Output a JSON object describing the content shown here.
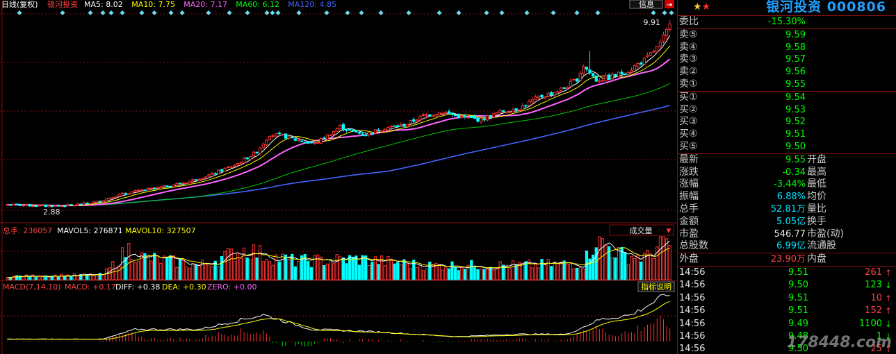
{
  "chart_header": {
    "period_label": "日线(复权)",
    "stock_name": "银河投资",
    "ma": [
      {
        "label": "MA5: 8.02",
        "color": "#ffffff"
      },
      {
        "label": "MA10: 7.75",
        "color": "#ffff00"
      },
      {
        "label": "MA20: 7.17",
        "color": "#ff66ff"
      },
      {
        "label": "MA60: 6.12",
        "color": "#00ff00"
      },
      {
        "label": "MA120: 4.85",
        "color": "#4466ff"
      }
    ],
    "buttons": [
      "信息",
      "指标说明"
    ],
    "high_label": "9.91",
    "low_label": "2.88"
  },
  "volume_header": {
    "total": "总手: 236057",
    "mavol5": "MAVOL5: 276871",
    "mavol10": "MAVOL10: 327507",
    "dropdown": "成交量"
  },
  "macd_header": {
    "name": "MACD(7,14,10)",
    "macd": "MACD: +0.17",
    "diff": "DIFF: +0.38",
    "dea": "DEA: +0.30",
    "zero": "ZERO: +0.00",
    "button": "指标说明"
  },
  "colors": {
    "up": "#ff3333",
    "down": "#00ffff",
    "grid": "#8a1010"
  },
  "panel": {
    "title": "银河投资 000806",
    "wei_bi": {
      "label": "委比",
      "value": "-15.30%"
    },
    "sell": [
      {
        "label": "卖⑤",
        "price": "9.59"
      },
      {
        "label": "卖④",
        "price": "9.58"
      },
      {
        "label": "卖③",
        "price": "9.57"
      },
      {
        "label": "卖②",
        "price": "9.56"
      },
      {
        "label": "卖①",
        "price": "9.55"
      }
    ],
    "buy": [
      {
        "label": "买①",
        "price": "9.54"
      },
      {
        "label": "买②",
        "price": "9.53"
      },
      {
        "label": "买③",
        "price": "9.52"
      },
      {
        "label": "买④",
        "price": "9.51"
      },
      {
        "label": "买⑤",
        "price": "9.50"
      }
    ],
    "stats": [
      {
        "l": "最新",
        "v": "9.55",
        "vc": "grn",
        "l2": "开盘"
      },
      {
        "l": "涨跌",
        "v": "-0.34",
        "vc": "grn",
        "l2": "最高"
      },
      {
        "l": "涨幅",
        "v": "-3.44%",
        "vc": "grn",
        "l2": "最低"
      },
      {
        "l": "振幅",
        "v": "6.88%",
        "vc": "cyan",
        "l2": "均价"
      },
      {
        "l": "总手",
        "v": "52.81万",
        "vc": "cyan",
        "l2": "量比"
      },
      {
        "l": "金额",
        "v": "5.05亿",
        "vc": "cyan",
        "l2": "换手"
      },
      {
        "l": "市盈",
        "v": "546.77",
        "vc": "wht",
        "l2": "市盈(动)"
      },
      {
        "l": "总股数",
        "v": "6.99亿",
        "vc": "cyan",
        "l2": "流通股"
      },
      {
        "l": "外盘",
        "v": "23.90万",
        "vc": "red",
        "l2": "内盘"
      }
    ],
    "ticks": [
      {
        "t": "14:56",
        "p": "9.51",
        "v": "261",
        "d": "up"
      },
      {
        "t": "14:56",
        "p": "9.50",
        "v": "123",
        "d": "down"
      },
      {
        "t": "14:56",
        "p": "9.51",
        "v": "10",
        "d": "up"
      },
      {
        "t": "14:56",
        "p": "9.51",
        "v": "152",
        "d": "up"
      },
      {
        "t": "14:56",
        "p": "9.49",
        "v": "1100",
        "d": "down"
      },
      {
        "t": "14:56",
        "p": "9.48",
        "v": "1",
        "d": "down"
      },
      {
        "t": "14:56",
        "p": "9.50",
        "v": "25",
        "d": "up"
      }
    ],
    "watermark": "178448.com"
  },
  "chart_data": {
    "type": "candlestick",
    "y_axis": {
      "min": 2.5,
      "max": 10.2
    },
    "price_keyframes": [
      [
        0,
        2.95
      ],
      [
        12,
        2.9
      ],
      [
        20,
        2.92
      ],
      [
        28,
        3.05
      ],
      [
        34,
        3.3
      ],
      [
        40,
        3.45
      ],
      [
        48,
        3.6
      ],
      [
        56,
        3.8
      ],
      [
        64,
        4.1
      ],
      [
        72,
        4.5
      ],
      [
        78,
        4.95
      ],
      [
        82,
        5.6
      ],
      [
        86,
        5.55
      ],
      [
        90,
        5.4
      ],
      [
        96,
        5.25
      ],
      [
        100,
        5.55
      ],
      [
        104,
        5.9
      ],
      [
        108,
        5.7
      ],
      [
        112,
        5.6
      ],
      [
        118,
        5.85
      ],
      [
        124,
        5.95
      ],
      [
        130,
        6.3
      ],
      [
        136,
        6.45
      ],
      [
        142,
        6.25
      ],
      [
        148,
        6.15
      ],
      [
        154,
        6.45
      ],
      [
        160,
        6.6
      ],
      [
        166,
        7.0
      ],
      [
        170,
        7.15
      ],
      [
        174,
        7.35
      ],
      [
        178,
        7.7
      ],
      [
        180,
        8.2
      ],
      [
        184,
        7.65
      ],
      [
        188,
        7.75
      ],
      [
        194,
        8.0
      ],
      [
        200,
        8.5
      ],
      [
        204,
        9.0
      ],
      [
        206,
        9.5
      ],
      [
        207,
        9.89
      ]
    ],
    "volume_keyframes": [
      [
        0,
        0.08
      ],
      [
        30,
        0.12
      ],
      [
        38,
        0.75
      ],
      [
        42,
        0.55
      ],
      [
        60,
        0.35
      ],
      [
        75,
        0.75
      ],
      [
        80,
        0.6
      ],
      [
        90,
        0.45
      ],
      [
        110,
        0.5
      ],
      [
        130,
        0.35
      ],
      [
        160,
        0.35
      ],
      [
        180,
        0.4
      ],
      [
        184,
        1.0
      ],
      [
        192,
        0.6
      ],
      [
        200,
        0.55
      ],
      [
        205,
        1.0
      ],
      [
        207,
        0.85
      ]
    ],
    "macd_keyframes": [
      [
        0,
        0.05
      ],
      [
        30,
        0.05
      ],
      [
        40,
        0.25
      ],
      [
        60,
        0.25
      ],
      [
        80,
        0.55
      ],
      [
        95,
        0.25
      ],
      [
        115,
        0.2
      ],
      [
        140,
        0.1
      ],
      [
        160,
        0.15
      ],
      [
        175,
        0.15
      ],
      [
        185,
        0.45
      ],
      [
        195,
        0.55
      ],
      [
        207,
        1.0
      ]
    ]
  }
}
